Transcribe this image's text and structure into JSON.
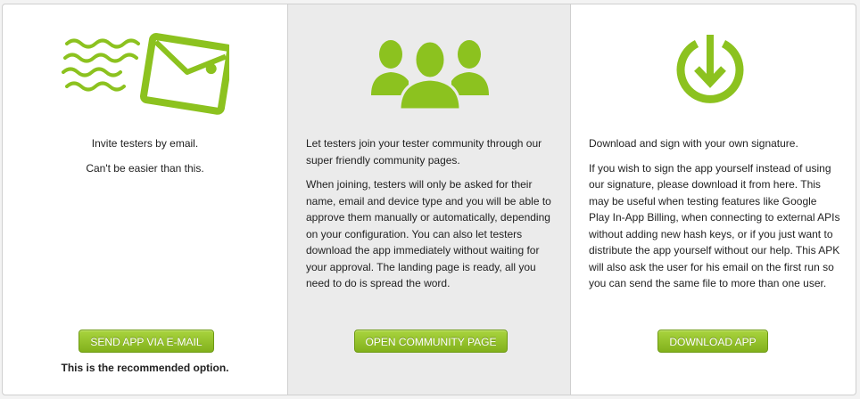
{
  "colors": {
    "accent": "#8cc21f",
    "button_text": "#ffffff"
  },
  "panels": [
    {
      "icon": "postcard-email-icon",
      "paragraphs": [
        "Invite testers by email.",
        "Can't be easier than this."
      ],
      "button": "SEND APP VIA E-MAIL",
      "note": "This is the recommended option."
    },
    {
      "icon": "community-group-icon",
      "paragraphs": [
        "Let testers join your tester community through our super friendly community pages.",
        "When joining, testers will only be asked for their name, email and device type and you will be able to approve them manually or automatically, depending on your configuration. You can also let testers download the app immediately without waiting for your approval. The landing page is ready, all you need to do is spread the word."
      ],
      "button": "OPEN COMMUNITY PAGE"
    },
    {
      "icon": "download-circle-icon",
      "paragraphs": [
        "Download and sign with your own signature.",
        "If you wish to sign the app yourself instead of using our signature, please download it from here. This may be useful when testing features like Google Play In-App Billing, when connecting to external APIs without adding new hash keys, or if you just want to distribute the app yourself without our help. This APK will also ask the user for his email on the first run so you can send the same file to more than one user."
      ],
      "button": "DOWNLOAD APP"
    }
  ]
}
